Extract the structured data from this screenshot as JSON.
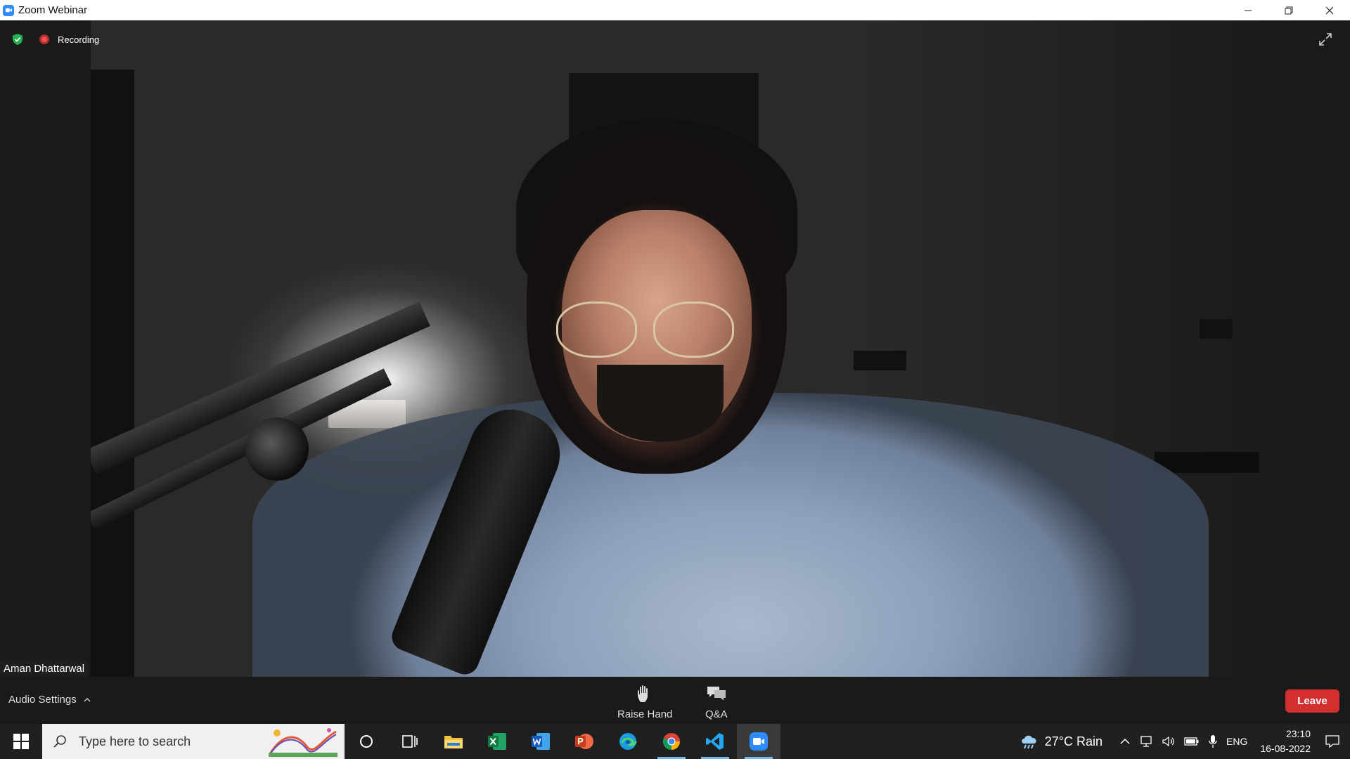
{
  "window": {
    "title": "Zoom Webinar"
  },
  "status": {
    "recording_label": "Recording"
  },
  "video": {
    "participant_name": "Aman Dhattarwal"
  },
  "controls": {
    "audio_settings_label": "Audio Settings",
    "raise_hand_label": "Raise Hand",
    "qa_label": "Q&A",
    "leave_label": "Leave"
  },
  "taskbar": {
    "search_placeholder": "Type here to search",
    "apps": [
      "cortana",
      "task-view",
      "file-explorer",
      "excel",
      "word",
      "powerpoint",
      "edge",
      "chrome",
      "vscode",
      "zoom"
    ],
    "weather": "27°C  Rain",
    "language": "ENG",
    "time": "23:10",
    "date": "16-08-2022"
  },
  "colors": {
    "leave": "#d32f2f",
    "zoom_blue": "#2d8cff",
    "recording": "#f05050",
    "shield": "#23b14d"
  }
}
